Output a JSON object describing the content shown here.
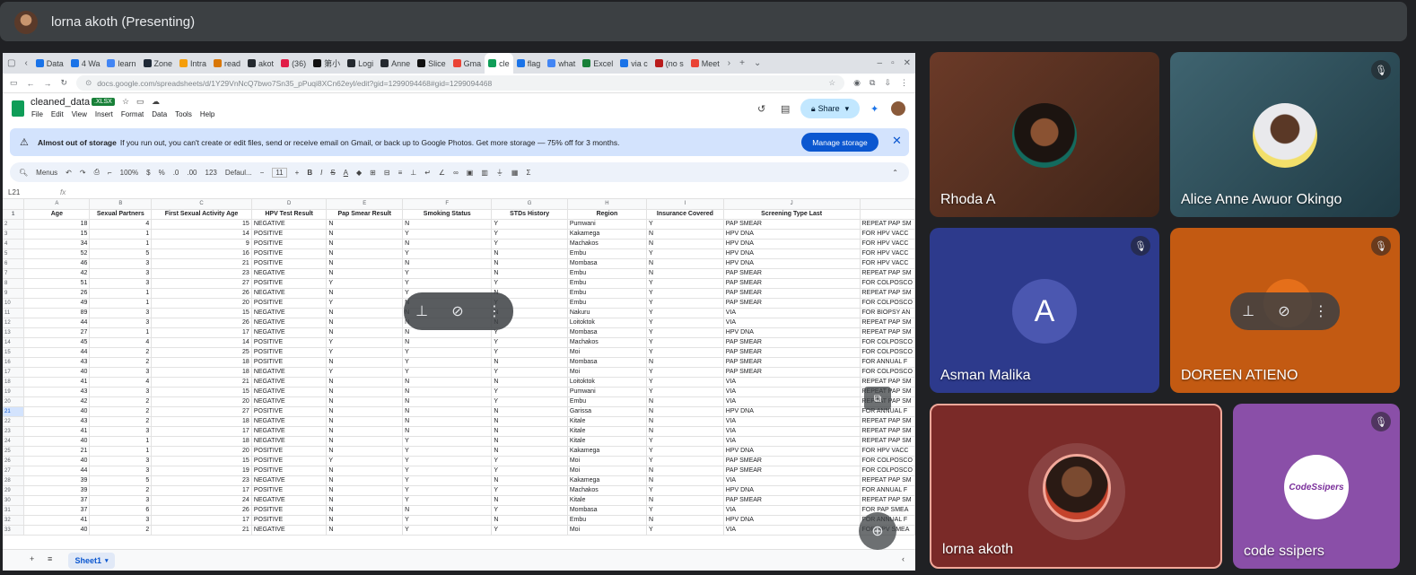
{
  "meeting": {
    "presenter_title": "lorna akoth (Presenting)"
  },
  "browser": {
    "tabs": [
      "Data",
      "4 Wa",
      "learn",
      "Zone",
      "Intra",
      "read",
      "akot",
      "(36)",
      "第小",
      "Logi",
      "Anne",
      "Slice",
      "Gma",
      "cle",
      "flag",
      "what",
      "Excel",
      "via c",
      "(no s",
      "Meet"
    ],
    "url": "docs.google.com/spreadsheets/d/1Y29VnNcQ7bwo7Sn35_pPuqi8XCn62eyl/edit?gid=1299094468#gid=1299094468"
  },
  "sheet": {
    "doc_name": "cleaned_data",
    "badge": ".XLSX",
    "menus": [
      "File",
      "Edit",
      "View",
      "Insert",
      "Format",
      "Data",
      "Tools",
      "Help"
    ],
    "share_label": "Share",
    "banner_title": "Almost out of storage",
    "banner_text": "If you run out, you can't create or edit files, send or receive email on Gmail, or back up to Google Photos. Get more storage — 75% off for 3 months.",
    "banner_button": "Manage storage",
    "toolbar": {
      "menus": "Menus",
      "zoom": "100%",
      "currency": "$",
      "percent": "%",
      "dec_dec": ".0",
      "inc_dec": ".00",
      "num_fmt": "123",
      "font": "Defaul...",
      "font_size": "11"
    },
    "cell_ref": "L21",
    "fx": "fx",
    "col_letters": [
      "A",
      "B",
      "C",
      "D",
      "E",
      "F",
      "G",
      "H",
      "I",
      "J"
    ],
    "headers": [
      "Age",
      "Sexual Partners",
      "First Sexual Activity Age",
      "HPV Test Result",
      "Pap Smear Result",
      "Smoking Status",
      "STDs History",
      "Region",
      "Insurance Covered",
      "Screening Type Last"
    ],
    "rows": [
      [
        "18",
        "4",
        "15",
        "NEGATIVE",
        "N",
        "N",
        "Y",
        "Pumwani",
        "Y",
        "PAP SMEAR",
        "REPEAT PAP SM"
      ],
      [
        "15",
        "1",
        "14",
        "POSITIVE",
        "N",
        "Y",
        "Y",
        "Kakamega",
        "N",
        "HPV DNA",
        "FOR HPV VACC"
      ],
      [
        "34",
        "1",
        "9",
        "POSITIVE",
        "N",
        "N",
        "Y",
        "Machakos",
        "N",
        "HPV DNA",
        "FOR HPV VACC"
      ],
      [
        "52",
        "5",
        "16",
        "POSITIVE",
        "N",
        "Y",
        "N",
        "Embu",
        "Y",
        "HPV DNA",
        "FOR HPV VACC"
      ],
      [
        "46",
        "3",
        "21",
        "POSITIVE",
        "N",
        "N",
        "N",
        "Mombasa",
        "N",
        "HPV DNA",
        "FOR HPV VACC"
      ],
      [
        "42",
        "3",
        "23",
        "NEGATIVE",
        "N",
        "Y",
        "N",
        "Embu",
        "N",
        "PAP SMEAR",
        "REPEAT PAP SM"
      ],
      [
        "51",
        "3",
        "27",
        "POSITIVE",
        "Y",
        "Y",
        "Y",
        "Embu",
        "Y",
        "PAP SMEAR",
        "FOR COLPOSCO"
      ],
      [
        "26",
        "1",
        "26",
        "NEGATIVE",
        "N",
        "Y",
        "N",
        "Embu",
        "Y",
        "PAP SMEAR",
        "REPEAT PAP SM"
      ],
      [
        "49",
        "1",
        "20",
        "POSITIVE",
        "Y",
        "N",
        "Y",
        "Embu",
        "Y",
        "PAP SMEAR",
        "FOR COLPOSCO"
      ],
      [
        "89",
        "3",
        "15",
        "NEGATIVE",
        "N",
        "N",
        "N",
        "Nakuru",
        "Y",
        "VIA",
        "FOR BIOPSY AN"
      ],
      [
        "44",
        "3",
        "26",
        "NEGATIVE",
        "N",
        "N",
        "N",
        "Loitoktok",
        "Y",
        "VIA",
        "REPEAT PAP SM"
      ],
      [
        "27",
        "1",
        "17",
        "NEGATIVE",
        "N",
        "N",
        "Y",
        "Mombasa",
        "Y",
        "HPV DNA",
        "REPEAT PAP SM"
      ],
      [
        "45",
        "4",
        "14",
        "POSITIVE",
        "Y",
        "N",
        "Y",
        "Machakos",
        "Y",
        "PAP SMEAR",
        "FOR COLPOSCO"
      ],
      [
        "44",
        "2",
        "25",
        "POSITIVE",
        "Y",
        "Y",
        "Y",
        "Moi",
        "Y",
        "PAP SMEAR",
        "FOR COLPOSCO"
      ],
      [
        "43",
        "2",
        "18",
        "POSITIVE",
        "N",
        "Y",
        "N",
        "Mombasa",
        "N",
        "PAP SMEAR",
        "FOR ANNUAL F"
      ],
      [
        "40",
        "3",
        "18",
        "NEGATIVE",
        "Y",
        "Y",
        "Y",
        "Moi",
        "Y",
        "PAP SMEAR",
        "FOR COLPOSCO"
      ],
      [
        "41",
        "4",
        "21",
        "NEGATIVE",
        "N",
        "N",
        "N",
        "Loitoktok",
        "Y",
        "VIA",
        "REPEAT PAP SM"
      ],
      [
        "43",
        "3",
        "15",
        "NEGATIVE",
        "N",
        "N",
        "Y",
        "Pumwani",
        "Y",
        "VIA",
        "REPEAT PAP SM"
      ],
      [
        "42",
        "2",
        "20",
        "NEGATIVE",
        "N",
        "N",
        "Y",
        "Embu",
        "N",
        "VIA",
        "REPEAT PAP SM"
      ],
      [
        "40",
        "2",
        "27",
        "POSITIVE",
        "N",
        "N",
        "N",
        "Garissa",
        "N",
        "HPV DNA",
        "FOR ANNUAL F"
      ],
      [
        "43",
        "2",
        "18",
        "NEGATIVE",
        "N",
        "N",
        "N",
        "Kitale",
        "N",
        "VIA",
        "REPEAT PAP SM"
      ],
      [
        "41",
        "3",
        "17",
        "NEGATIVE",
        "N",
        "N",
        "N",
        "Kitale",
        "N",
        "VIA",
        "REPEAT PAP SM"
      ],
      [
        "40",
        "1",
        "18",
        "NEGATIVE",
        "N",
        "Y",
        "N",
        "Kitale",
        "Y",
        "VIA",
        "REPEAT PAP SM"
      ],
      [
        "21",
        "1",
        "20",
        "POSITIVE",
        "N",
        "Y",
        "N",
        "Kakamega",
        "Y",
        "HPV DNA",
        "FOR HPV VACC"
      ],
      [
        "40",
        "3",
        "15",
        "POSITIVE",
        "Y",
        "Y",
        "Y",
        "Moi",
        "Y",
        "PAP SMEAR",
        "FOR COLPOSCO"
      ],
      [
        "44",
        "3",
        "19",
        "POSITIVE",
        "N",
        "Y",
        "Y",
        "Moi",
        "N",
        "PAP SMEAR",
        "FOR COLPOSCO"
      ],
      [
        "39",
        "5",
        "23",
        "NEGATIVE",
        "N",
        "Y",
        "N",
        "Kakamega",
        "N",
        "VIA",
        "REPEAT PAP SM"
      ],
      [
        "39",
        "2",
        "17",
        "POSITIVE",
        "N",
        "Y",
        "Y",
        "Machakos",
        "Y",
        "HPV DNA",
        "FOR ANNUAL F"
      ],
      [
        "37",
        "3",
        "24",
        "NEGATIVE",
        "N",
        "Y",
        "N",
        "Kitale",
        "N",
        "PAP SMEAR",
        "REPEAT PAP SM"
      ],
      [
        "37",
        "6",
        "26",
        "POSITIVE",
        "N",
        "N",
        "Y",
        "Mombasa",
        "Y",
        "VIA",
        "FOR PAP SMEA"
      ],
      [
        "41",
        "3",
        "17",
        "POSITIVE",
        "N",
        "Y",
        "N",
        "Embu",
        "N",
        "HPV DNA",
        "FOR ANNUAL F"
      ],
      [
        "40",
        "2",
        "21",
        "NEGATIVE",
        "N",
        "Y",
        "Y",
        "Moi",
        "Y",
        "VIA",
        "FOR HPV SMEA"
      ]
    ],
    "sheet_tab": "Sheet1"
  },
  "participants": [
    {
      "name": "Rhoda A"
    },
    {
      "name": "Alice Anne Awuor Okingo"
    },
    {
      "name": "Asman Malika",
      "initial": "A"
    },
    {
      "name": "DOREEN ATIENO"
    },
    {
      "name": "lorna akoth"
    },
    {
      "name": "code ssipers",
      "logo_text": "CodeSsipers"
    }
  ],
  "colors": {
    "meet_bg": "#202124",
    "asman_tile": "#2d3a8c",
    "doreen_tile": "#c35a12",
    "lorna_tile": "#7a2a28",
    "code_tile": "#8a4fa8"
  },
  "icons": [
    "pin-icon",
    "mute-icon",
    "more-icon",
    "mic-off-icon",
    "warning-icon",
    "close-icon"
  ]
}
